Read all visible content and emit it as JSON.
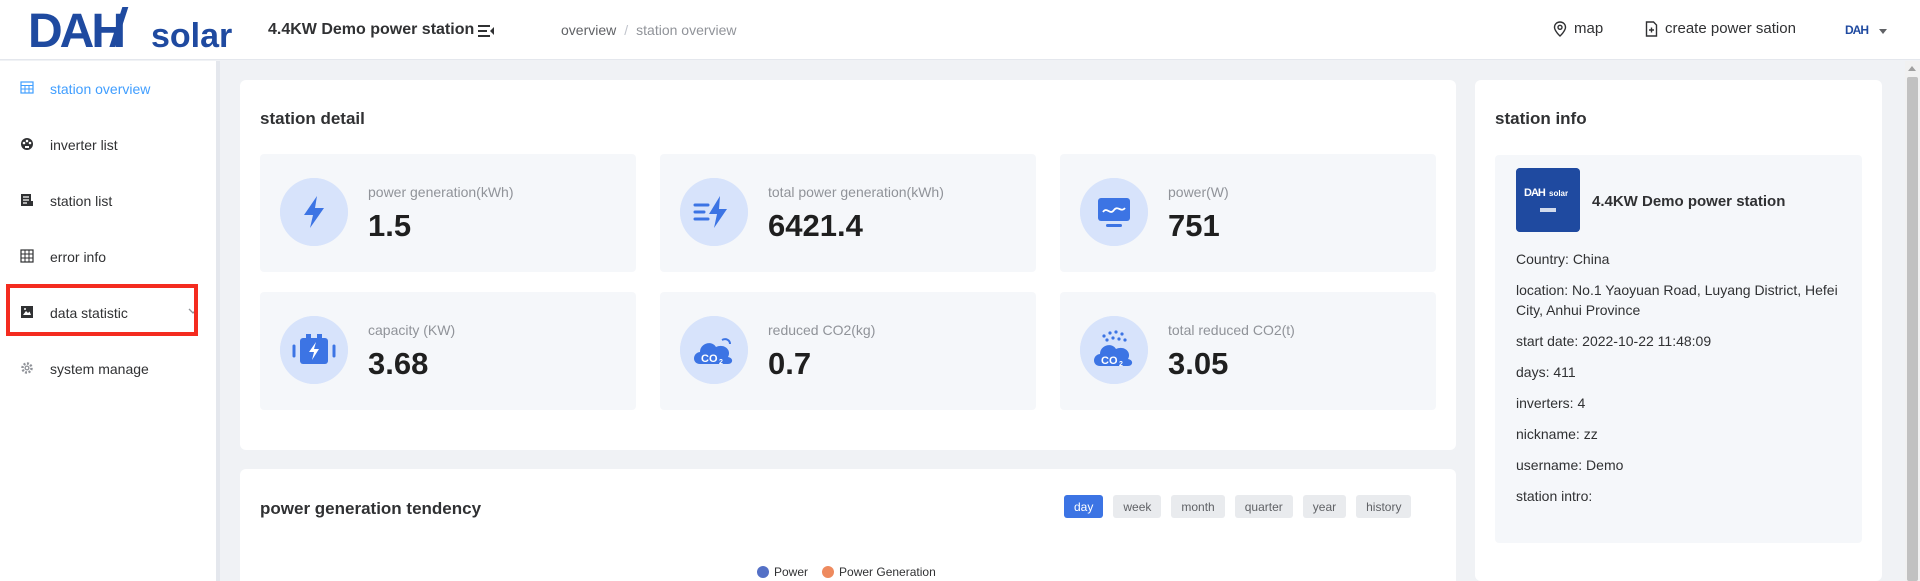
{
  "header": {
    "logo_alt": "DAH Solar",
    "site_title": "4.4KW Demo power station",
    "breadcrumb": [
      "overview",
      "station overview"
    ],
    "breadcrumb_sep": "/",
    "map_label": "map",
    "create_label": "create power sation"
  },
  "sidebar": {
    "items": [
      {
        "label": "station overview",
        "icon": "table-icon",
        "active": true
      },
      {
        "label": "inverter list",
        "icon": "gauge-icon"
      },
      {
        "label": "station list",
        "icon": "list-icon"
      },
      {
        "label": "error info",
        "icon": "grid-icon"
      },
      {
        "label": "data statistic",
        "icon": "image-icon"
      },
      {
        "label": "system manage",
        "icon": "gear-icon"
      }
    ]
  },
  "station_detail": {
    "title": "station detail",
    "stats": [
      {
        "label": "power generation(kWh)",
        "value": "1.5",
        "icon": "bolt-icon"
      },
      {
        "label": "total power generation(kWh)",
        "value": "6421.4",
        "icon": "fast-bolt-icon"
      },
      {
        "label": "power(W)",
        "value": "751",
        "icon": "monitor-icon"
      },
      {
        "label": "capacity (KW)",
        "value": "3.68",
        "icon": "battery-icon"
      },
      {
        "label": "reduced CO2(kg)",
        "value": "0.7",
        "icon": "co2-cloud-icon"
      },
      {
        "label": "total reduced CO2(t)",
        "value": "3.05",
        "icon": "co2-cloud-dots-icon"
      }
    ]
  },
  "station_info": {
    "title": "station info",
    "name": "4.4KW Demo power station",
    "country_k": "Country:",
    "country_v": "China",
    "location_k": "location:",
    "location_v": "No.1 Yaoyuan Road, Luyang District, Hefei City, Anhui Province",
    "start_k": "start date:",
    "start_v": "2022-10-22 11:48:09",
    "days_k": "days:",
    "days_v": "411",
    "inverters_k": "inverters:",
    "inverters_v": "4",
    "nickname_k": "nickname:",
    "nickname_v": "zz",
    "username_k": "username:",
    "username_v": "Demo",
    "intro_k": "station intro:",
    "intro_v": ""
  },
  "tendency": {
    "title": "power generation tendency",
    "tabs": [
      "day",
      "week",
      "month",
      "quarter",
      "year",
      "history"
    ],
    "active_tab": "day",
    "legend": [
      {
        "name": "Power",
        "color": "#5470c6"
      },
      {
        "name": "Power Generation",
        "color": "#ee8a5e"
      }
    ]
  },
  "colors": {
    "accent": "#409eff",
    "brand_blue": "#1f4aa0",
    "active_tab": "#3c74e4",
    "highlight": "#f42b1f"
  }
}
